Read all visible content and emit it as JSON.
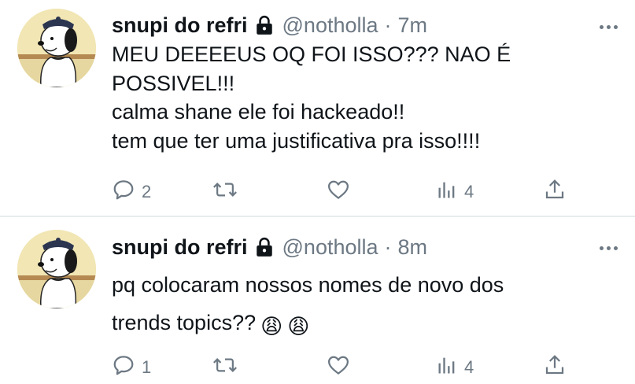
{
  "tweets": [
    {
      "name": "snupi do refri",
      "handle": "@notholla",
      "separator": "·",
      "time": "7m",
      "lines": [
        "MEU DEEEEUS OQ FOI ISSO??? NAO É",
        "POSSIVEL!!!",
        "calma shane ele foi hackeado!!",
        "tem que ter uma justificativa pra isso!!!!"
      ],
      "replies": "2",
      "views": "4",
      "icons": [
        "lock-icon",
        "more-icon",
        "reply-icon",
        "retweet-icon",
        "like-icon",
        "views-icon",
        "share-icon"
      ]
    },
    {
      "name": "snupi do refri",
      "handle": "@notholla",
      "separator": "·",
      "time": "8m",
      "lines": [
        "pq colocaram nossos nomes de novo dos",
        "trends topics??"
      ],
      "emoji": [
        "😩",
        "😩"
      ],
      "replies": "1",
      "views": "4",
      "icons": [
        "lock-icon",
        "more-icon",
        "reply-icon",
        "retweet-icon",
        "like-icon",
        "views-icon",
        "share-icon",
        "weary-face-emoji"
      ]
    }
  ],
  "colors": {
    "text": "#0f1419",
    "secondary": "#6c7883",
    "divider": "#e7ebee",
    "avatar_bg": "#f1e6b4"
  }
}
